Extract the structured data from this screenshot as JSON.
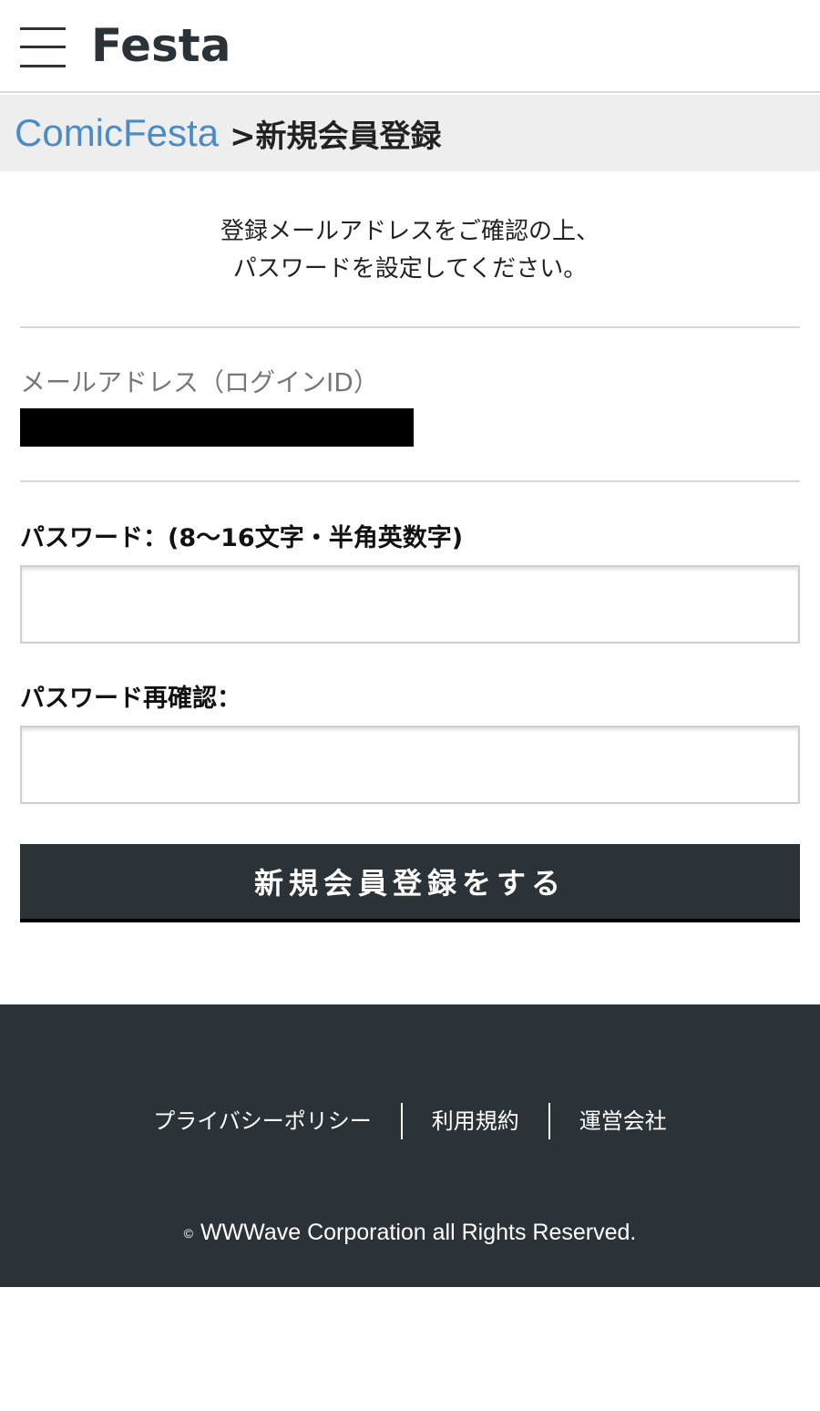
{
  "header": {
    "menu_icon": "hamburger-menu-icon",
    "logo_text": "Festa"
  },
  "breadcrumb": {
    "link": "ComicFesta",
    "current": ">新規会員登録"
  },
  "intro": {
    "line1": "登録メールアドレスをご確認の上、",
    "line2": "パスワードを設定してください。"
  },
  "email": {
    "label": "メールアドレス（ログインID）",
    "value_redacted": true
  },
  "password": {
    "label": "パスワード：(8〜16文字・半角英数字)",
    "value": "",
    "placeholder": ""
  },
  "password_confirm": {
    "label": "パスワード再確認：",
    "value": "",
    "placeholder": ""
  },
  "submit": {
    "label": "新規会員登録をする"
  },
  "footer": {
    "links": [
      "プライバシーポリシー",
      "利用規約",
      "運営会社"
    ],
    "copyright_mark": "©",
    "copyright": "WWWave Corporation all Rights Reserved."
  },
  "colors": {
    "header_dark": "#2b3338",
    "link_blue": "#4a8cc7",
    "breadcrumb_bg": "#eeeeee"
  }
}
